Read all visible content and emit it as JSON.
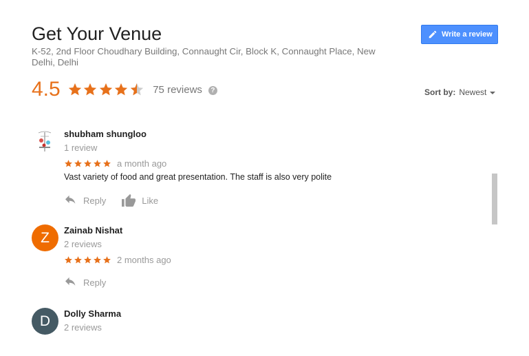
{
  "place": {
    "name": "Get Your Venue",
    "address": "K-52, 2nd Floor Choudhary Building, Connaught Cir, Block K, Connaught Place, New Delhi, Delhi"
  },
  "write_review_label": "Write a review",
  "rating": {
    "value": "4.5",
    "stars": 4.5,
    "count_label": "75 reviews"
  },
  "sort": {
    "label": "Sort by:",
    "value": "Newest"
  },
  "colors": {
    "star": "#e7711b",
    "button": "#4d90fe",
    "avatar_z": "#ef6c00",
    "avatar_d": "#455a64"
  },
  "reviews": [
    {
      "name": "shubham shungloo",
      "count": "1 review",
      "stars": 5,
      "ago": "a month ago",
      "text": "Vast variety of food and great presentation. The staff is  also very polite",
      "reply": "Reply",
      "like": "Like",
      "avatar": "photo"
    },
    {
      "name": "Zainab Nishat",
      "count": "2 reviews",
      "stars": 5,
      "ago": "2 months ago",
      "reply": "Reply",
      "avatar_letter": "Z"
    },
    {
      "name": "Dolly Sharma",
      "count": "2 reviews",
      "avatar_letter": "D"
    }
  ]
}
